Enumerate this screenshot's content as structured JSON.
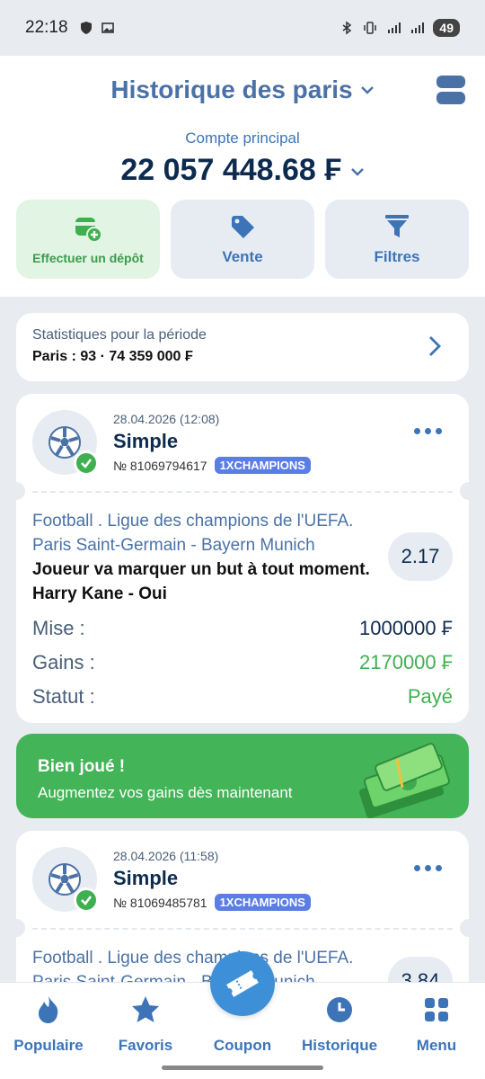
{
  "statusbar": {
    "time": "22:18",
    "battery": "49"
  },
  "header": {
    "title": "Historique des paris",
    "account_label": "Compte principal",
    "balance": "22 057 448.68 ₣",
    "actions": [
      {
        "label": "Effectuer un dépôt",
        "icon": "wallet-add-icon"
      },
      {
        "label": "Vente",
        "icon": "tag-icon"
      },
      {
        "label": "Filtres",
        "icon": "filter-icon"
      }
    ]
  },
  "stats": {
    "title": "Statistiques pour la période",
    "summary": "Paris : 93 · 74 359 000 ₣"
  },
  "bets": [
    {
      "date": "28.04.2026 (12:08)",
      "type": "Simple",
      "number": "№ 81069794617",
      "promo": "1XCHAMPIONS",
      "league": "Football . Ligue des champions de l'UEFA.",
      "match": "Paris Saint-Germain - Bayern Munich",
      "selection": "Joueur va marquer un but à tout moment. Harry Kane - Oui",
      "odds": "2.17",
      "stake_label": "Mise :",
      "stake": "1000000 ₣",
      "winnings_label": "Gains :",
      "winnings": "2170000 ₣",
      "status_label": "Statut :",
      "status": "Payé"
    },
    {
      "date": "28.04.2026 (11:58)",
      "type": "Simple",
      "number": "№ 81069485781",
      "promo": "1XCHAMPIONS",
      "league": "Football . Ligue des champions de l'UEFA.",
      "match": "Paris Saint-Germain - Bayern Munich",
      "odds": "3.84"
    }
  ],
  "banner": {
    "title": "Bien joué !",
    "subtitle": "Augmentez vos gains dès maintenant"
  },
  "nav": [
    {
      "label": "Populaire",
      "icon": "flame-icon"
    },
    {
      "label": "Favoris",
      "icon": "star-icon"
    },
    {
      "label": "Coupon",
      "icon": "ticket-icon"
    },
    {
      "label": "Historique",
      "icon": "clock-icon"
    },
    {
      "label": "Menu",
      "icon": "grid-icon"
    }
  ],
  "colors": {
    "primary": "#3d74b8",
    "green": "#3fb04f",
    "banner": "#43b457",
    "navy": "#0d2b4f"
  }
}
